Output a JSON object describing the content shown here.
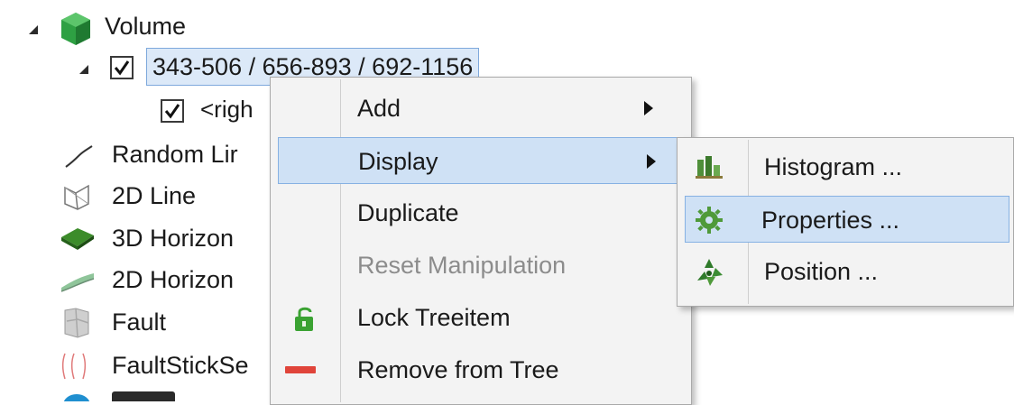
{
  "tree": {
    "root_label": "Volume",
    "volume_item_label": "343-506 / 656-893 / 692-1156",
    "child_label": "<righ",
    "items": [
      {
        "label": "Random Lir"
      },
      {
        "label": "2D Line"
      },
      {
        "label": "3D Horizon"
      },
      {
        "label": "2D Horizon"
      },
      {
        "label": "Fault"
      },
      {
        "label": "FaultStickSe"
      }
    ]
  },
  "context_menu": {
    "items": [
      {
        "label": "Add"
      },
      {
        "label": "Display"
      },
      {
        "label": "Duplicate"
      },
      {
        "label": "Reset Manipulation"
      },
      {
        "label": "Lock Treeitem"
      },
      {
        "label": "Remove from Tree"
      }
    ]
  },
  "submenu": {
    "items": [
      {
        "label": "Histogram ..."
      },
      {
        "label": "Properties ..."
      },
      {
        "label": "Position ..."
      }
    ]
  },
  "colors": {
    "highlight": "#cfe1f5",
    "highlight_border": "#86b1e3",
    "cube_green": "#2ea043",
    "lock_green": "#3aa232",
    "remove_red": "#e0443a"
  }
}
